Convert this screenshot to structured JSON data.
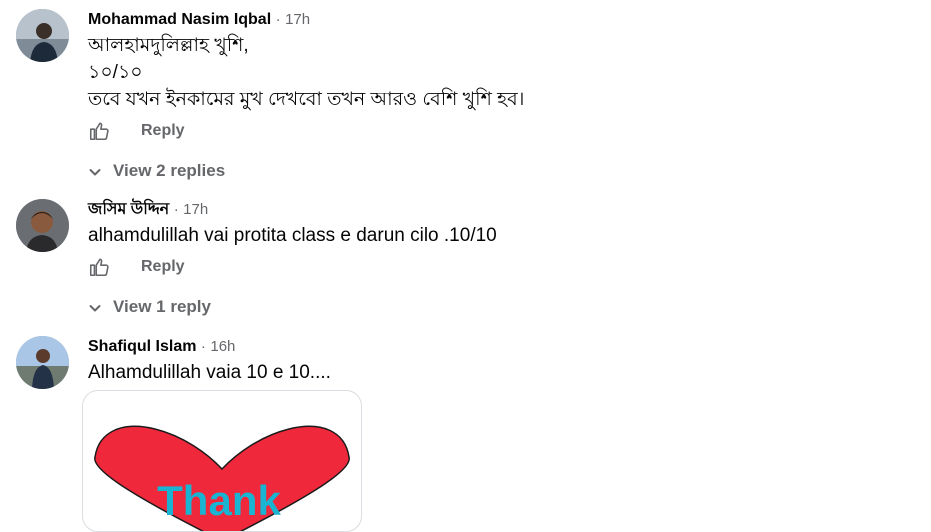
{
  "comments": [
    {
      "author": "Mohammad Nasim Iqbal",
      "separator": "·",
      "time": "17h",
      "text": "আলহামদুলিল্লাহ খুশি,\n১০/১০\nতবে যখন ইনকামের মুখ দেখবো তখন আরও বেশি খুশি হব।",
      "reply_label": "Reply",
      "view_replies": "View 2 replies"
    },
    {
      "author": "জসিম উদ্দিন",
      "separator": "·",
      "time": "17h",
      "text": "alhamdulillah vai protita class e darun cilo .10/10",
      "reply_label": "Reply",
      "view_replies": "View 1 reply"
    },
    {
      "author": "Shafiqul Islam",
      "separator": "·",
      "time": "16h",
      "text": "Alhamdulillah vaia 10 e 10....",
      "image_text": "Thank"
    }
  ],
  "icons": {
    "like": "thumbs-up-icon",
    "expand": "chevron-down-icon"
  },
  "colors": {
    "secondary_text": "#65676b",
    "heart": "#f0283c",
    "image_text": "#19b4d2"
  }
}
